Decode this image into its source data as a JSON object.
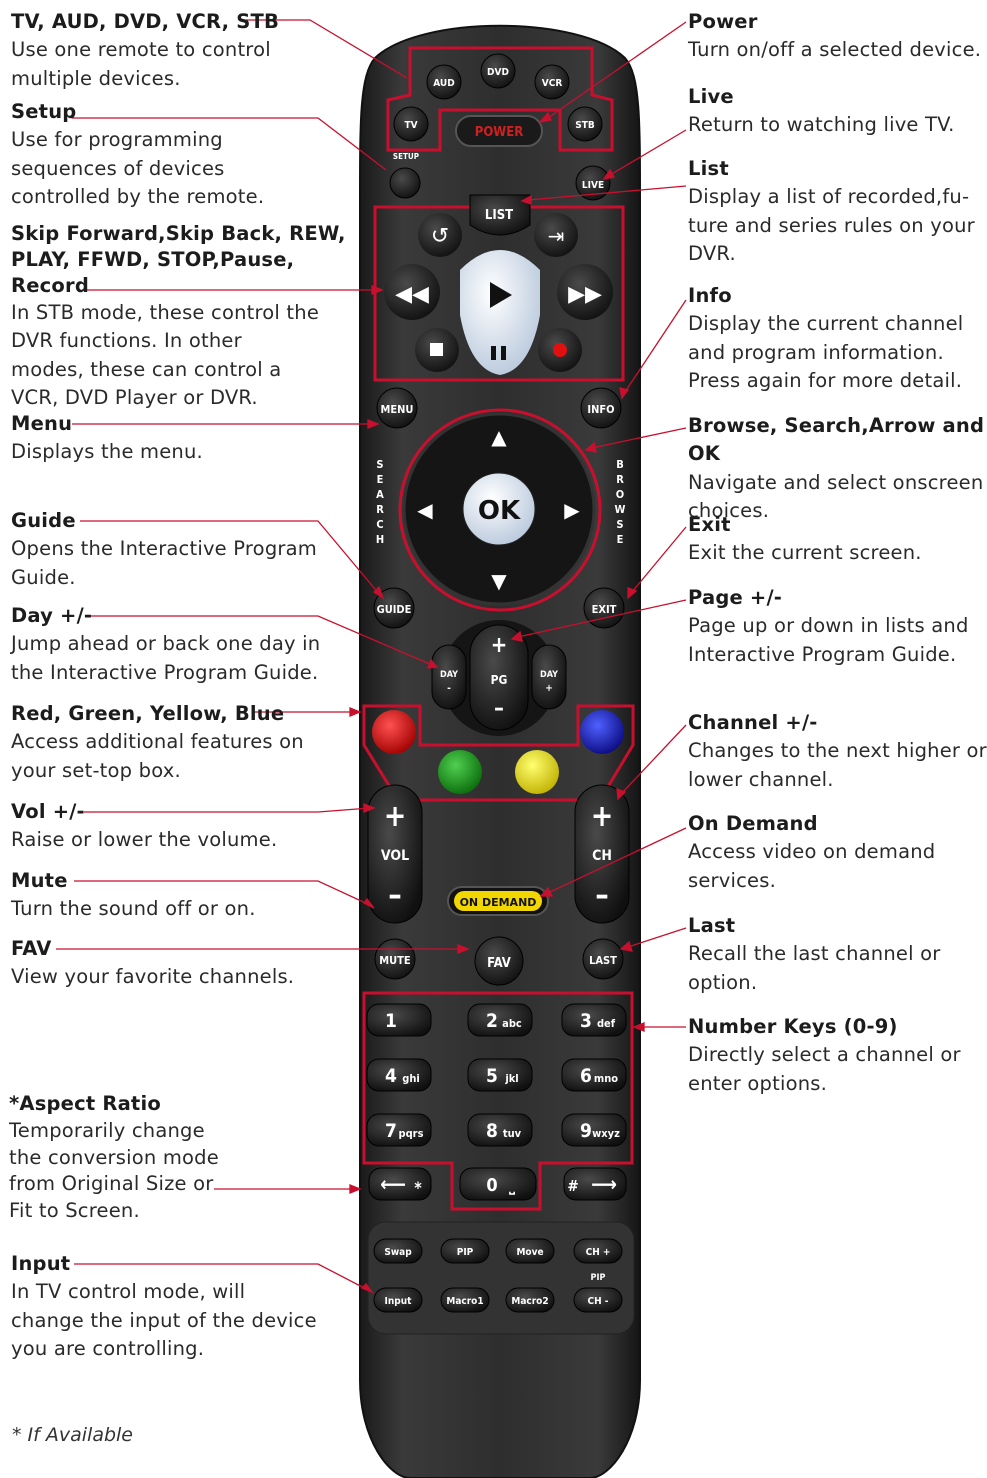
{
  "labels": [
    {
      "title": "TV, AUD, DVD, VCR, STB",
      "desc": "Use one remote to control\nmultiple devices."
    },
    {
      "title": "Setup",
      "desc": "Use for programming\nsequences of devices\ncontrolled by the remote."
    },
    {
      "title": "Skip Forward,Skip Back, REW,\nPLAY, FFWD, STOP,Pause,\nRecord",
      "desc": "In STB mode, these control the\nDVR functions. In other\nmodes, these can control a\nVCR, DVD Player or DVR."
    },
    {
      "title": "Menu",
      "desc": "Displays the menu."
    },
    {
      "title": "Guide",
      "desc": "Opens the Interactive Program\nGuide."
    },
    {
      "title": "Day +/-",
      "desc": "Jump ahead or back one day in\nthe Interactive Program Guide."
    },
    {
      "title": "Red, Green, Yellow, Blue",
      "desc": "Access additional features on\nyour set-top box."
    },
    {
      "title": "Vol +/-",
      "desc": "Raise or lower the volume."
    },
    {
      "title": "Mute",
      "desc": "Turn the sound off or on."
    },
    {
      "title": "FAV",
      "desc": "View your favorite channels."
    },
    {
      "title": "*Aspect Ratio",
      "desc": "Temporarily change\nthe conversion mode\nfrom Original Size or\nFit to Screen."
    },
    {
      "title": "Input",
      "desc": "In TV control mode, will\nchange the input of the device\nyou are controlling."
    },
    {
      "title": "Power",
      "desc": "Turn on/off a selected device."
    },
    {
      "title": "Live",
      "desc": "Return to watching live TV."
    },
    {
      "title": "List",
      "desc": "Display a list of recorded,fu-\nture and series rules on your\nDVR."
    },
    {
      "title": "Info",
      "desc": "Display the current channel\nand program information.\nPress again for more detail."
    },
    {
      "title": "Browse, Search,Arrow and OK",
      "desc": "Navigate and select onscreen\nchoices."
    },
    {
      "title": "Exit",
      "desc": "Exit the current screen."
    },
    {
      "title": "Page +/-",
      "desc": "Page up or down in lists and\nInteractive Program Guide."
    },
    {
      "title": "Channel +/-",
      "desc": "Changes to the next higher or\nlower channel."
    },
    {
      "title": "On Demand",
      "desc": "Access video on demand\nservices."
    },
    {
      "title": "Last",
      "desc": "Recall the last channel or\noption."
    },
    {
      "title": "Number Keys (0-9)",
      "desc": "Directly select a channel or\nenter options."
    }
  ],
  "footnote": "* If Available",
  "remote": {
    "device_buttons": [
      "AUD",
      "DVD",
      "VCR",
      "TV",
      "STB"
    ],
    "power": "POWER",
    "setup": "SETUP",
    "live": "LIVE",
    "list": "LIST",
    "menu": "MENU",
    "info": "INFO",
    "ok": "OK",
    "search": "SEARCH",
    "browse": "BROWSE",
    "guide": "GUIDE",
    "exit": "EXIT",
    "day_minus": "DAY\n-",
    "day_plus": "DAY\n+",
    "pg": "PG",
    "vol": "VOL",
    "ch": "CH",
    "on_demand": "ON DEMAND",
    "mute": "MUTE",
    "fav": "FAV",
    "last": "LAST",
    "numkeys": [
      {
        "n": "1",
        "s": ""
      },
      {
        "n": "2",
        "s": "abc"
      },
      {
        "n": "3",
        "s": "def"
      },
      {
        "n": "4",
        "s": "ghi"
      },
      {
        "n": "5",
        "s": "jkl"
      },
      {
        "n": "6",
        "s": "mno"
      },
      {
        "n": "7",
        "s": "pqrs"
      },
      {
        "n": "8",
        "s": "tuv"
      },
      {
        "n": "9",
        "s": "wxyz"
      }
    ],
    "zero": "0",
    "star": "*",
    "hash": "#",
    "bottom_row1": [
      "Swap",
      "PIP",
      "Move",
      "CH +"
    ],
    "pip_label": "PIP",
    "bottom_row2": [
      "Input",
      "Macro1",
      "Macro2",
      "CH -"
    ]
  },
  "colors": {
    "remote_body": "#2b2b2b",
    "accent_red": "#c8102e",
    "red": "#d01010",
    "green": "#1a9a1a",
    "yellow": "#f0e000",
    "blue": "#1020b0",
    "on_demand": "#f2d600"
  }
}
